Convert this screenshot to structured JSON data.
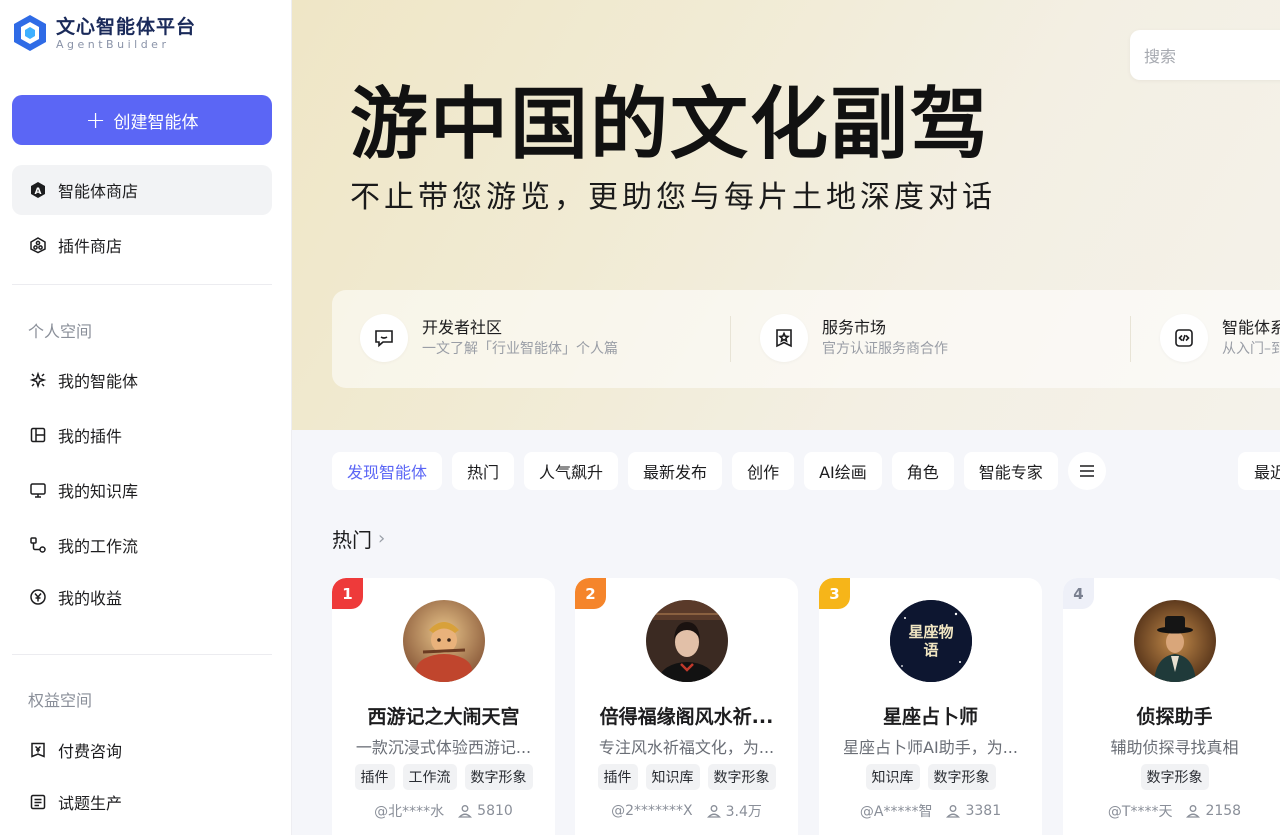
{
  "brand": {
    "title": "文心智能体平台",
    "subtitle": "AgentBuilder",
    "accent": "#5b66f5"
  },
  "sidebar": {
    "create_label": "创建智能体",
    "top_items": [
      {
        "label": "智能体商店",
        "icon": "agent-store-icon",
        "active": true
      },
      {
        "label": "插件商店",
        "icon": "plugin-store-icon",
        "active": false
      }
    ],
    "personal_title": "个人空间",
    "personal_items": [
      {
        "label": "我的智能体",
        "icon": "sparkle-icon"
      },
      {
        "label": "我的插件",
        "icon": "layout-icon"
      },
      {
        "label": "我的知识库",
        "icon": "monitor-icon"
      },
      {
        "label": "我的工作流",
        "icon": "workflow-icon"
      },
      {
        "label": "我的收益",
        "icon": "yen-icon"
      }
    ],
    "rights_title": "权益空间",
    "rights_items": [
      {
        "label": "付费咨询",
        "icon": "yen-doc-icon"
      },
      {
        "label": "试题生产",
        "icon": "list-doc-icon"
      }
    ]
  },
  "search": {
    "placeholder": "搜索"
  },
  "banner": {
    "title": "游中国的文化副驾",
    "subtitle": "不止带您游览，更助您与每片土地深度对话"
  },
  "entries": [
    {
      "title": "开发者社区",
      "desc": "一文了解「行业智能体」个人篇",
      "icon": "chat-icon"
    },
    {
      "title": "服务市场",
      "desc": "官方认证服务商合作",
      "icon": "badge-star-icon"
    },
    {
      "title": "智能体系",
      "desc": "从入门–到",
      "icon": "code-icon"
    }
  ],
  "tabs": [
    {
      "label": "发现智能体",
      "active": true
    },
    {
      "label": "热门"
    },
    {
      "label": "人气飙升"
    },
    {
      "label": "最新发布"
    },
    {
      "label": "创作"
    },
    {
      "label": "AI绘画"
    },
    {
      "label": "角色"
    },
    {
      "label": "智能专家"
    }
  ],
  "more_tabs_icon": "menu-icon",
  "sort_label": "最近",
  "section_title": "热门",
  "cards": [
    {
      "rank": "1",
      "rank_color": "#ee3a3a",
      "name": "西游记之大闹天宫",
      "desc": "一款沉浸式体验西游记...",
      "tags": [
        "插件",
        "工作流",
        "数字形象"
      ],
      "author": "@北****水",
      "uses": "5810",
      "avatar": "monkey-king-avatar"
    },
    {
      "rank": "2",
      "rank_color": "#f5852b",
      "name": "倍得福缘阁风水祈...",
      "desc": "专注风水祈福文化，为...",
      "tags": [
        "插件",
        "知识库",
        "数字形象"
      ],
      "author": "@2*******X",
      "uses": "3.4万",
      "avatar": "woman-portrait-avatar"
    },
    {
      "rank": "3",
      "rank_color": "#f6b519",
      "name": "星座占卜师",
      "desc": "星座占卜师AI助手，为...",
      "tags": [
        "知识库",
        "数字形象"
      ],
      "author": "@A*****智",
      "uses": "3381",
      "avatar": "constellation-avatar",
      "avatar_text": "星座物语"
    },
    {
      "rank": "4",
      "rank_color": "#eef0f8",
      "rank_text_color": "#7a8090",
      "name": "侦探助手",
      "desc": "辅助侦探寻找真相",
      "tags": [
        "数字形象"
      ],
      "author": "@T****天",
      "uses": "2158",
      "avatar": "detective-avatar"
    }
  ]
}
